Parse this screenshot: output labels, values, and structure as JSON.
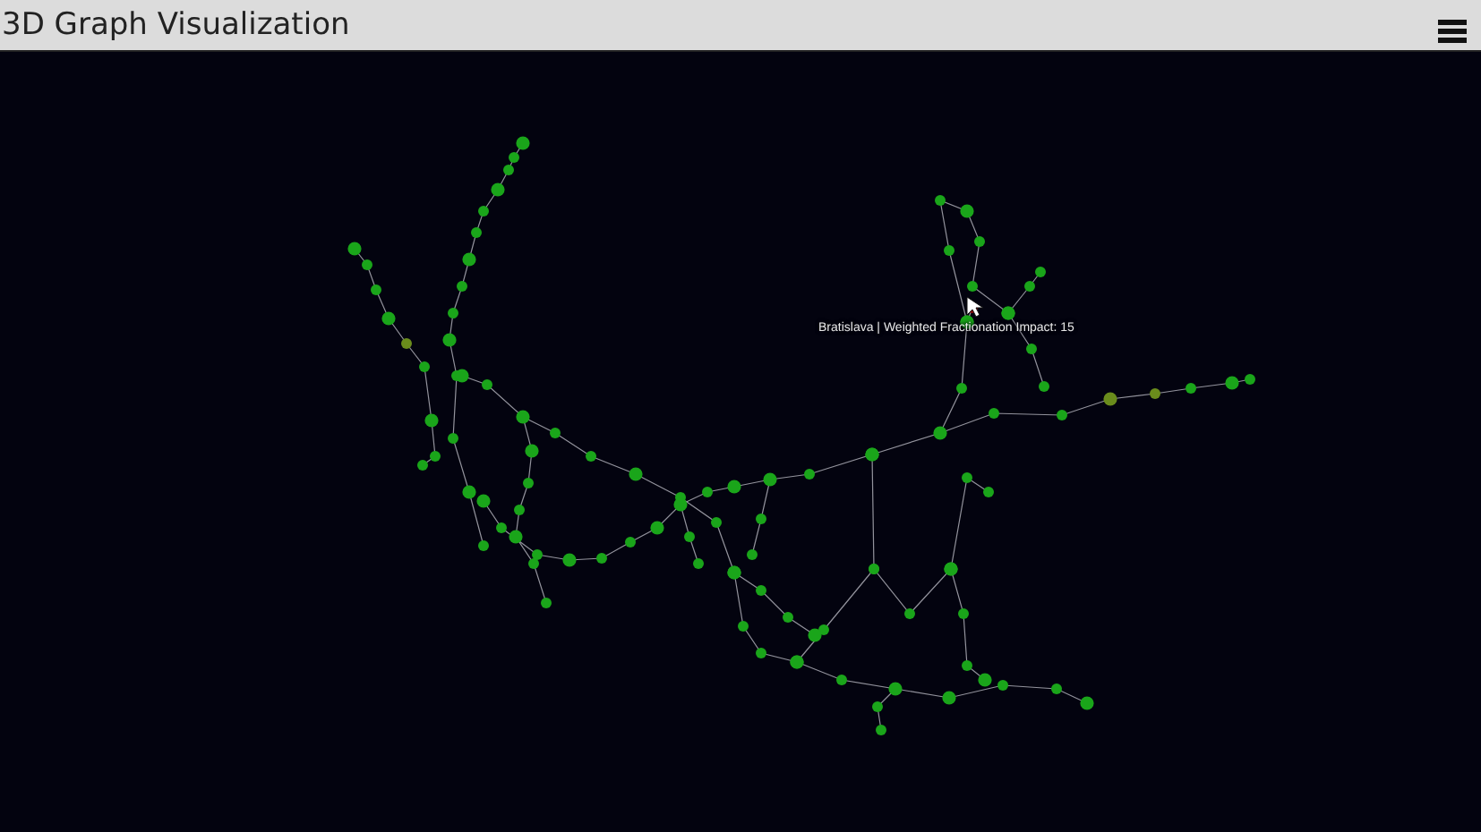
{
  "header": {
    "title": "3D Graph Visualization"
  },
  "tooltip": {
    "text": "Bratislava | Weighted Fractionation Impact: 15"
  }
}
